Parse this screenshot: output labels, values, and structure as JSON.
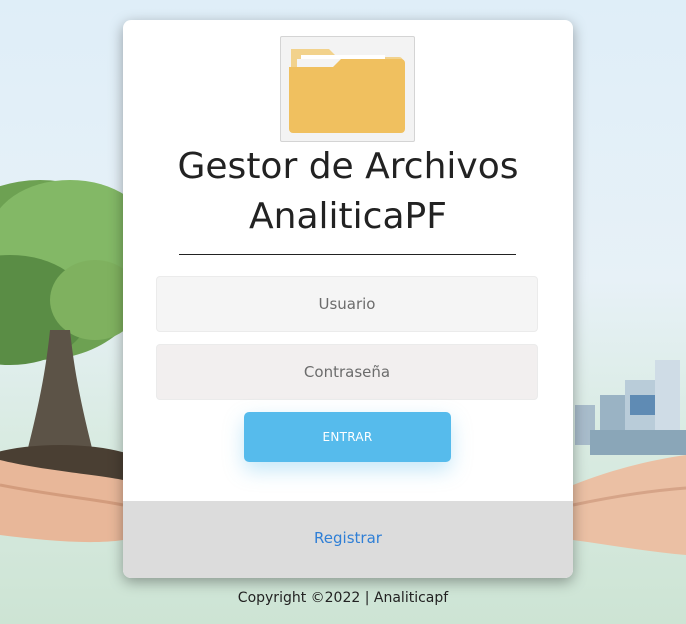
{
  "login": {
    "logo_icon": "folder-icon",
    "title_line1": "Gestor de Archivos",
    "title_line2": "AnaliticaPF",
    "username_placeholder": "Usuario",
    "password_placeholder": "Contraseña",
    "submit_label": "ENTRAR",
    "register_label": "Registrar"
  },
  "footer": {
    "copyright": "Copyright ©2022 | Analiticapf"
  },
  "colors": {
    "button": "#56bbec",
    "link": "#2f7fd6",
    "folder": "#f0c05f",
    "card_footer": "#dcdcdc"
  }
}
